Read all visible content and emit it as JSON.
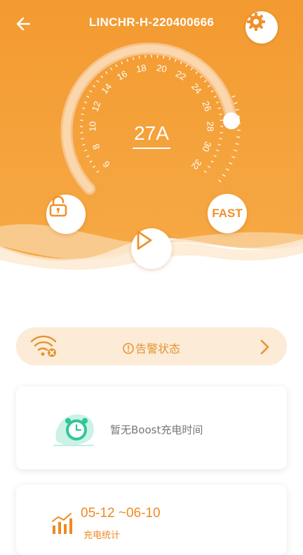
{
  "header": {
    "title": "LINCHR-H-220400666",
    "back_icon": "back-arrow-icon",
    "settings_icon": "gear-icon"
  },
  "dial": {
    "current_value": "27A",
    "ticks": [
      "6",
      "8",
      "10",
      "12",
      "14",
      "16",
      "18",
      "20",
      "22",
      "24",
      "26",
      "28",
      "30",
      "32"
    ],
    "min": 6,
    "max": 32,
    "setting": 27
  },
  "controls": {
    "lock_icon": "unlock-icon",
    "fast_label": "FAST",
    "play_icon": "play-icon"
  },
  "alarm": {
    "label": "告警状态",
    "wifi_icon": "wifi-off-icon",
    "chevron_icon": "chevron-right-icon"
  },
  "boost": {
    "text": "暂无Boost充电时间",
    "icon": "alarm-clock-icon"
  },
  "stats": {
    "range": "05-12 ~06-10",
    "label": "充电统计",
    "icon": "bar-chart-icon"
  },
  "colors": {
    "primary": "#f39a30",
    "accent": "#ef8a22",
    "alarm_bg": "#fcebd6"
  }
}
